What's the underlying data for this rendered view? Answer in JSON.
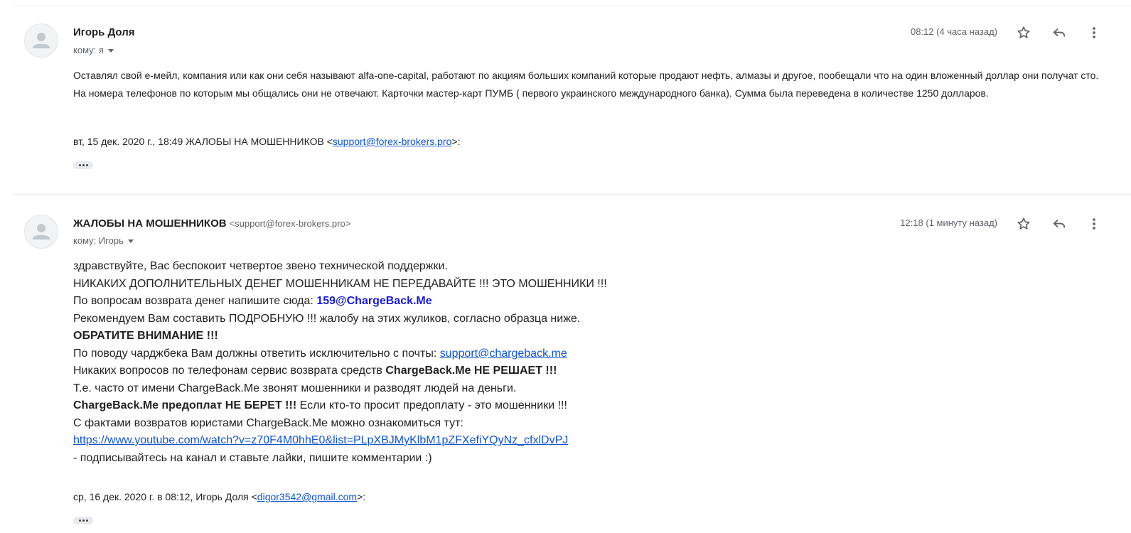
{
  "messages": [
    {
      "sender_name": "Игорь Доля",
      "sender_email": "",
      "to_label": "кому: я",
      "time": "08:12 (4 часа назад)",
      "body": " Оставлял свой е-мейл, компания или как они себя называют alfa-one-capital, работают по акциям больших компаний которые продают нефть, алмазы и другое, пообещали что на один вложенный доллар они получат сто. На номера телефонов по которым мы общались они не отвечают. Карточки мастер-карт ПУМБ ( первого украинского международного банка). Сумма была переведена в количестве 1250 долларов.",
      "quote": {
        "prefix": "вт, 15 дек. 2020 г., 18:49 ЖАЛОБЫ НА МОШЕННИКОВ <",
        "email": "support@forex-brokers.pro",
        "suffix": ">:"
      }
    },
    {
      "sender_name": "ЖАЛОБЫ НА МОШЕННИКОВ",
      "sender_email": "<support@forex-brokers.pro>",
      "to_label": "кому: Игорь",
      "time": "12:18 (1 минуту назад)",
      "body": {
        "l1": "здравствуйте, Вас беспокоит четвертое звено технической поддержки.",
        "l2": "НИКАКИХ ДОПОЛНИТЕЛЬНЫХ ДЕНЕГ МОШЕННИКАМ НЕ ПЕРЕДАВАЙТЕ !!! ЭТО МОШЕННИКИ !!!",
        "l3_text": "По вопросам возврата денег напишите сюда: ",
        "l3_email": "159@ChargeBack.Me",
        "l4": "Рекомендуем Вам составить ПОДРОБНУЮ !!! жалобу на этих жуликов, согласно образца ниже.",
        "l5": "ОБРАТИТЕ ВНИМАНИЕ !!!",
        "l6_text": "По поводу чарджбека Вам должны ответить исключительно с почты: ",
        "l6_link": "support@chargeback.me",
        "l7_text": "Никаких вопросов по телефонам сервис возврата средств ",
        "l7_bold": "ChargeBack.Me НЕ РЕШАЕТ !!!",
        "l8": "Т.е. часто от имени ChargeBack.Me звонят мошенники и разводят людей на деньги.",
        "l9_bold": "ChargeBack.Me предоплат НЕ БЕРЕТ !!!",
        "l9_text": " Если кто-то просит предоплату - это мошенники !!!",
        "l10": "С фактами возвратов юристами ChargeBack.Me можно ознакомиться тут:",
        "l11_link": "https://www.youtube.com/watch?v=z70F4M0hhE0&list=PLpXBJMyKlbM1pZFXefiYQyNz_cfxlDvPJ",
        "l12": " - подписывайтесь на канал и ставьте лайки, пишите комментарии :)"
      },
      "quote": {
        "prefix": "ср, 16 дек. 2020 г. в 08:12, Игорь Доля <",
        "email": "digor3542@gmail.com",
        "suffix": ">:"
      }
    }
  ],
  "icons": {
    "avatar": "person-icon",
    "star": "star-icon",
    "reply": "reply-icon",
    "more": "more-vert-icon",
    "expand": "ellipsis-icon",
    "dropdown": "caret-down-icon"
  },
  "colors": {
    "link": "#1155cc",
    "highlight_email": "#1a1acd",
    "secondary_text": "#5f6368",
    "body_text": "#222222"
  }
}
